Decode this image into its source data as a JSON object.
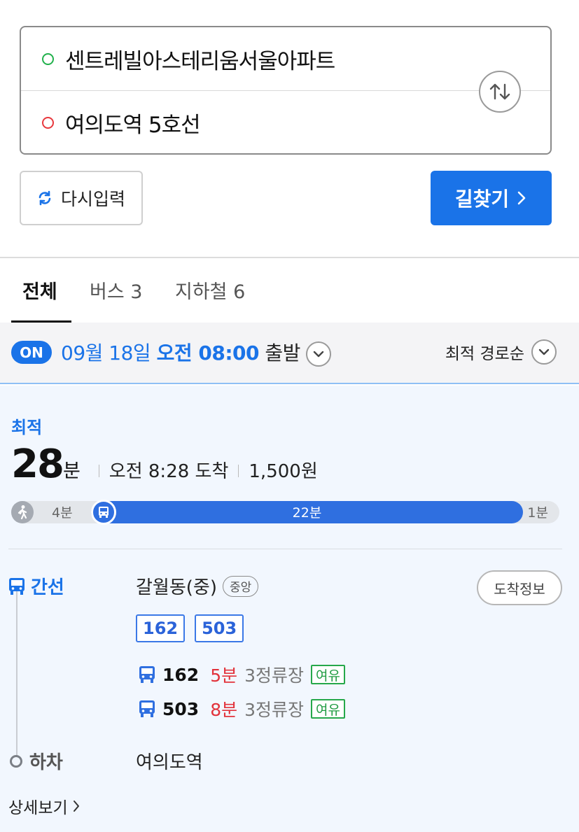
{
  "search": {
    "origin": "센트레빌아스테리움서울아파트",
    "destination": "여의도역 5호선"
  },
  "actions": {
    "reset_label": "다시입력",
    "search_label": "길찾기"
  },
  "tabs": [
    {
      "label": "전체"
    },
    {
      "label": "버스 3"
    },
    {
      "label": "지하철 6"
    }
  ],
  "filter": {
    "badge": "ON",
    "date": "09월 18일",
    "time": "오전 08:00",
    "suffix": "출발",
    "sort_label": "최적 경로순"
  },
  "route": {
    "label": "최적",
    "total_minutes": "28",
    "total_unit": "분",
    "arrival": "오전 8:28 도착",
    "fare": "1,500원",
    "timeline": {
      "walk_start": "4분",
      "bus": "22분",
      "walk_end": "1분"
    },
    "leg": {
      "type_label": "간선",
      "stop_name": "갈월동(중)",
      "stop_tag": "중앙",
      "arrival_button": "도착정보",
      "bus_numbers": [
        "162",
        "503"
      ],
      "arrivals": [
        {
          "number": "162",
          "minutes": "5분",
          "stops": "3정류장",
          "status": "여유"
        },
        {
          "number": "503",
          "minutes": "8분",
          "stops": "3정류장",
          "status": "여유"
        }
      ]
    },
    "get_off": {
      "label": "하차",
      "stop": "여의도역"
    },
    "detail_link": "상세보기"
  },
  "colors": {
    "accent": "#1a73e8",
    "bus": "#2f6fe0",
    "origin_dot": "#22b14c",
    "dest_dot": "#e8383d",
    "wait_red": "#e2323b",
    "status_green": "#26a84a"
  }
}
